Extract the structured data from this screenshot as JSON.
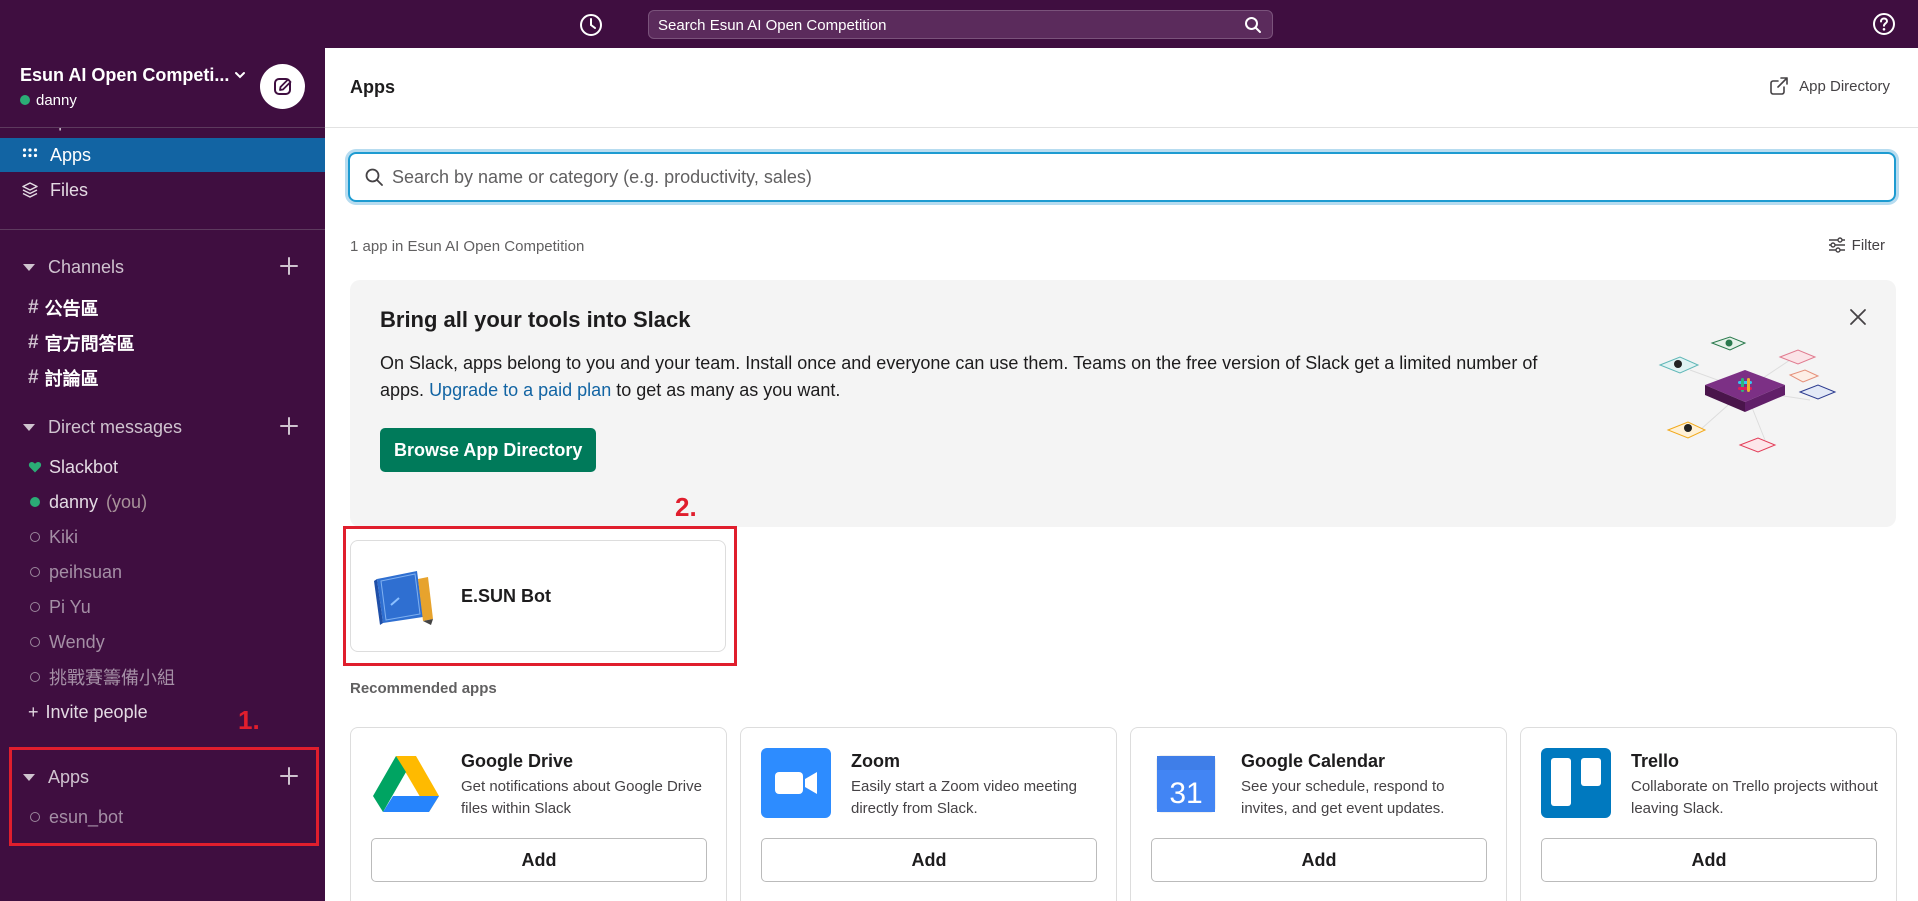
{
  "topbar": {
    "search_placeholder": "Search Esun AI Open Competition"
  },
  "sidebar": {
    "workspace_name": "Esun AI Open Competi...",
    "user_name": "danny",
    "partial_item": "People",
    "nav": [
      {
        "label": "Apps"
      },
      {
        "label": "Files"
      }
    ],
    "channels_header": "Channels",
    "channels": [
      "公告區",
      "官方問答區",
      "討論區"
    ],
    "dm_header": "Direct messages",
    "dms": [
      {
        "name": "Slackbot",
        "status": "bot"
      },
      {
        "name": "danny",
        "suffix": "(you)",
        "status": "online"
      },
      {
        "name": "Kiki",
        "status": "away"
      },
      {
        "name": "peihsuan",
        "status": "away"
      },
      {
        "name": "Pi Yu",
        "status": "away"
      },
      {
        "name": "Wendy",
        "status": "away"
      },
      {
        "name": "挑戰賽籌備小組",
        "status": "away"
      }
    ],
    "invite_label": "Invite people",
    "apps_header": "Apps",
    "apps": [
      {
        "name": "esun_bot"
      }
    ]
  },
  "annotations": {
    "label_1": "1.",
    "label_2": "2."
  },
  "main": {
    "title": "Apps",
    "app_directory_link": "App Directory",
    "search_placeholder": "Search by name or category (e.g. productivity, sales)",
    "count_text": "1 app in Esun AI Open Competition",
    "filter_label": "Filter",
    "promo": {
      "title": "Bring all your tools into Slack",
      "body_before": "On Slack, apps belong to you and your team. Install once and everyone can use them. Teams on the free version of Slack get a limited number of apps.",
      "link": "Upgrade to a paid plan",
      "body_after": "to get as many as you want.",
      "button": "Browse App Directory"
    },
    "installed_apps": [
      {
        "name": "E.SUN Bot"
      }
    ],
    "recommended_title": "Recommended apps",
    "recommended": [
      {
        "name": "Google Drive",
        "desc": "Get notifications about Google Drive files within Slack",
        "button": "Add",
        "icon": "google-drive-icon"
      },
      {
        "name": "Zoom",
        "desc": "Easily start a Zoom video meeting directly from Slack.",
        "button": "Add",
        "icon": "zoom-icon"
      },
      {
        "name": "Google Calendar",
        "desc": "See your schedule, respond to invites, and get event updates.",
        "button": "Add",
        "icon": "google-calendar-icon",
        "icon_text": "31"
      },
      {
        "name": "Trello",
        "desc": "Collaborate on Trello projects without leaving Slack.",
        "button": "Add",
        "icon": "trello-icon"
      }
    ]
  },
  "colors": {
    "aubergine": "#3f0e40",
    "active_blue": "#1264a3",
    "green_button": "#007a5a",
    "annotation_red": "#e01e2d"
  }
}
